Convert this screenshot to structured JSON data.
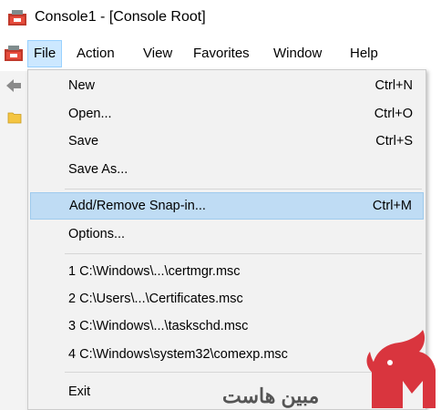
{
  "window": {
    "title": "Console1 - [Console Root]"
  },
  "menubar": {
    "items": [
      {
        "label": "File"
      },
      {
        "label": "Action"
      },
      {
        "label": "View"
      },
      {
        "label": "Favorites"
      },
      {
        "label": "Window"
      },
      {
        "label": "Help"
      }
    ]
  },
  "file_menu": {
    "items": [
      {
        "label": "New",
        "shortcut": "Ctrl+N"
      },
      {
        "label": "Open...",
        "shortcut": "Ctrl+O"
      },
      {
        "label": "Save",
        "shortcut": "Ctrl+S"
      },
      {
        "label": "Save As...",
        "shortcut": ""
      },
      {
        "label": "Add/Remove Snap-in...",
        "shortcut": "Ctrl+M"
      },
      {
        "label": "Options...",
        "shortcut": ""
      },
      {
        "label": "1 C:\\Windows\\...\\certmgr.msc",
        "shortcut": ""
      },
      {
        "label": "2 C:\\Users\\...\\Certificates.msc",
        "shortcut": ""
      },
      {
        "label": "3 C:\\Windows\\...\\taskschd.msc",
        "shortcut": ""
      },
      {
        "label": "4 C:\\Windows\\system32\\comexp.msc",
        "shortcut": ""
      },
      {
        "label": "Exit",
        "shortcut": ""
      }
    ]
  },
  "watermark": {
    "text": "مبین هاست"
  },
  "colors": {
    "highlight": "#bfdcf4",
    "logo_red": "#d9353e"
  }
}
